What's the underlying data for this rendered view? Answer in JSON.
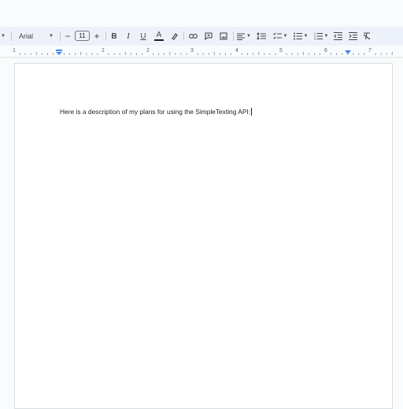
{
  "toolbar": {
    "font_name": "Arial",
    "font_size": "11",
    "minus_label": "−",
    "plus_label": "+",
    "bold_label": "B",
    "italic_label": "I",
    "underline_label": "U",
    "text_color_label": "A",
    "icons": [
      "dropdown-caret",
      "font-menu",
      "decrease-font-size",
      "increase-font-size",
      "bold",
      "italic",
      "underline",
      "text-color",
      "highlight",
      "link",
      "comment",
      "image",
      "align",
      "line-spacing",
      "checklist",
      "bulleted-list",
      "numbered-list",
      "decrease-indent",
      "increase-indent",
      "clear-formatting"
    ],
    "text_color_underline": "#1f1f1f"
  },
  "ruler": {
    "numbers": [
      "1",
      "1",
      "2",
      "3",
      "4",
      "5",
      "6",
      "7"
    ],
    "marker_color": "#4285f4"
  },
  "document": {
    "text": "Here is a description of my plans for using the SimpleTexting API:"
  }
}
